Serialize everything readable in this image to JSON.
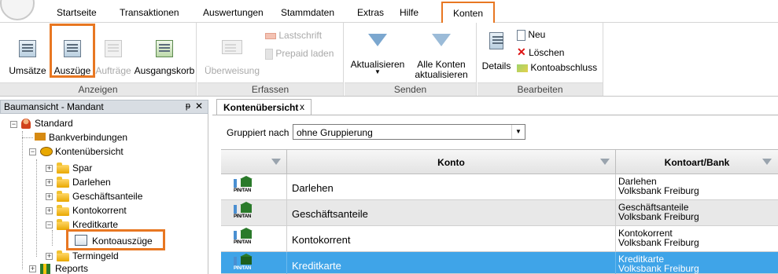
{
  "menu": {
    "items": [
      "Startseite",
      "Transaktionen",
      "Auswertungen",
      "Stammdaten",
      "Extras",
      "Hilfe"
    ],
    "active": "Konten"
  },
  "ribbon": {
    "anzeigen": {
      "label": "Anzeigen",
      "umsaetze": "Umsätze",
      "auszuege": "Auszüge",
      "auftraege": "Aufträge",
      "ausgangskorb": "Ausgangskorb"
    },
    "erfassen": {
      "label": "Erfassen",
      "ueberweisung": "Überweisung",
      "lastschrift": "Lastschrift",
      "prepaid": "Prepaid laden"
    },
    "senden": {
      "label": "Senden",
      "aktualisieren": "Aktualisieren",
      "alle_konten_1": "Alle Konten",
      "alle_konten_2": "aktualisieren"
    },
    "bearbeiten": {
      "label": "Bearbeiten",
      "details": "Details",
      "neu": "Neu",
      "loeschen": "Löschen",
      "kontoabschluss": "Kontoabschluss"
    }
  },
  "left_panel": {
    "title": "Baumansicht - Mandant",
    "pin_glyph": "ᵽ",
    "close_glyph": "✕",
    "tree": {
      "standard": "Standard",
      "bankverbindungen": "Bankverbindungen",
      "kontenuebersicht": "Kontenübersicht",
      "spar": "Spar",
      "darlehen": "Darlehen",
      "geschaeftsanteile": "Geschäftsanteile",
      "kontokorrent": "Kontokorrent",
      "kreditkarte": "Kreditkarte",
      "kontoauszuege": "Kontoauszüge",
      "termingeld": "Termingeld",
      "reports": "Reports"
    }
  },
  "right_panel": {
    "tab_label": "Kontenübersicht",
    "tab_close": "x",
    "group_by_label": "Gruppiert nach",
    "group_by_value": "ohne Gruppierung",
    "columns": {
      "konto": "Konto",
      "kontoart_bank": "Kontoart/Bank"
    },
    "pin_tan": "PIN/TAN",
    "rows": [
      {
        "konto": "Darlehen",
        "art": "Darlehen",
        "bank": "Volksbank Freiburg"
      },
      {
        "konto": "Geschäftsanteile",
        "art": "Geschäftsanteile",
        "bank": "Volksbank Freiburg"
      },
      {
        "konto": "Kontokorrent",
        "art": "Kontokorrent",
        "bank": "Volksbank Freiburg"
      },
      {
        "konto": "Kreditkarte",
        "art": "Kreditkarte",
        "bank": "Volksbank Freiburg"
      }
    ]
  },
  "colors": {
    "highlight": "#e87722",
    "selection": "#3fa4e8"
  }
}
